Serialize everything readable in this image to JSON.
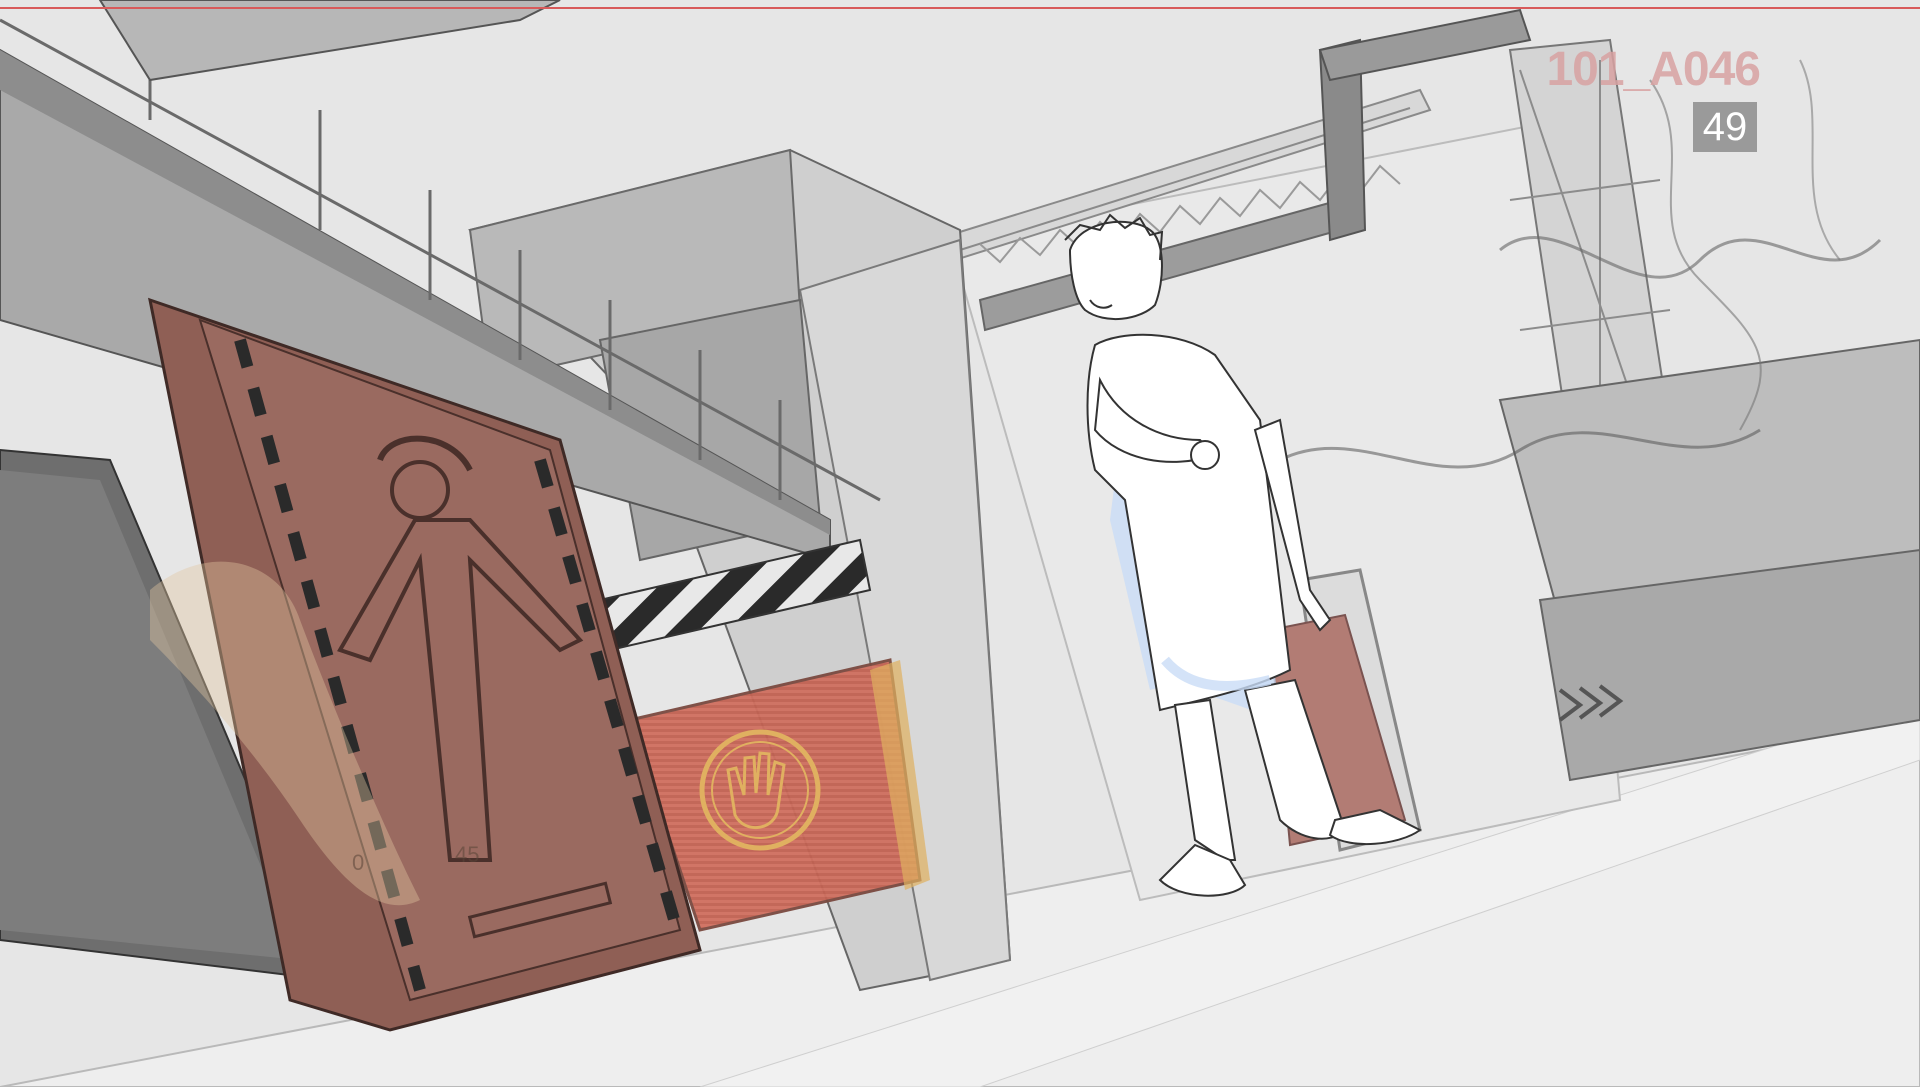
{
  "shot": {
    "label": "101_A046",
    "frame_number": "49"
  },
  "panel_marks": {
    "left": "0",
    "right": "45"
  },
  "colors": {
    "background": "#e6e6e6",
    "border_line": "#d85a5a",
    "hatch_door": "#8f5f55",
    "warning_screen": "#c96c5a",
    "character_shadow": "#c9dcf6",
    "counter_box": "#9a9a9a"
  },
  "icons": [
    "hand-stop-icon",
    "person-silhouette-icon",
    "chevron-arrows-icon"
  ]
}
